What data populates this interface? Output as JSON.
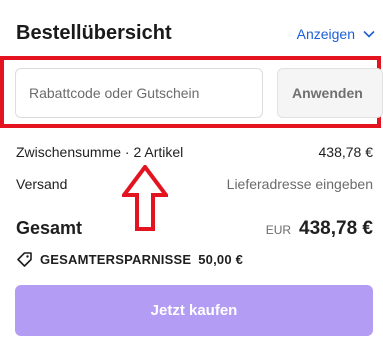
{
  "header": {
    "title": "Bestellübersicht",
    "toggle_label": "Anzeigen"
  },
  "discount": {
    "placeholder": "Rabattcode oder Gutschein",
    "apply_label": "Anwenden"
  },
  "subtotal": {
    "label": "Zwischensumme · 2 Artikel",
    "value": "438,78 €"
  },
  "shipping": {
    "label": "Versand",
    "value": "Lieferadresse eingeben"
  },
  "total": {
    "label": "Gesamt",
    "currency": "EUR",
    "value": "438,78 €"
  },
  "savings": {
    "label": "GESAMTERSPARNISSE",
    "value": "50,00 €"
  },
  "checkout": {
    "label": "Jetzt kaufen"
  },
  "colors": {
    "accent": "#1d5fd6",
    "highlight": "#e3141f",
    "checkout_bg": "#b39cf3"
  }
}
